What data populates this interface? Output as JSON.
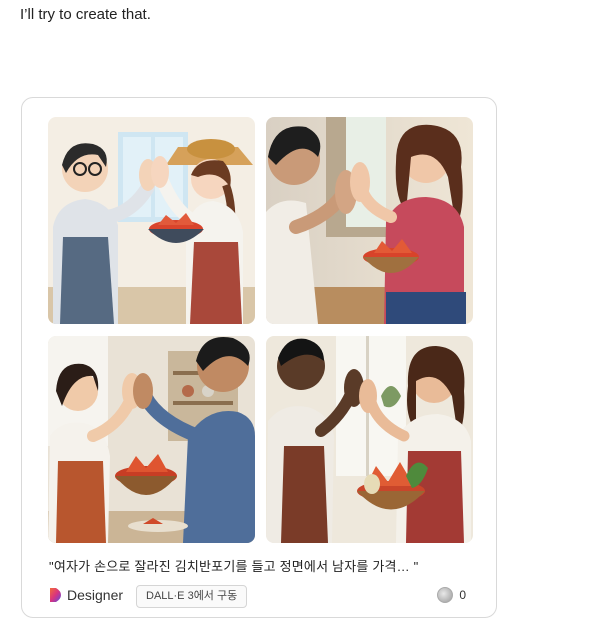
{
  "message": {
    "text": "I’ll try to create that."
  },
  "card": {
    "images": [
      {
        "icon": "cartoon-kimchi-high-five-image"
      },
      {
        "icon": "photo-kimchi-high-five-image"
      },
      {
        "icon": "photo-kitchen-high-five-image"
      },
      {
        "icon": "photo-apron-high-five-image"
      }
    ],
    "caption": "\"여자가 손으로 잘라진 김치반포기를 들고 정면에서 남자를 가격…   \"",
    "footer": {
      "brand": "Designer",
      "badge": "DALL·E 3에서 구동",
      "reaction_count": "0"
    }
  }
}
